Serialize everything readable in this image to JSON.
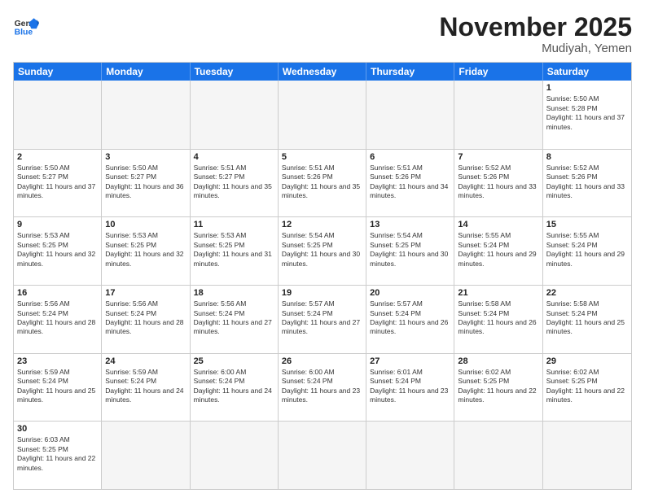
{
  "header": {
    "logo_general": "General",
    "logo_blue": "Blue",
    "month_title": "November 2025",
    "location": "Mudiyah, Yemen"
  },
  "weekdays": [
    "Sunday",
    "Monday",
    "Tuesday",
    "Wednesday",
    "Thursday",
    "Friday",
    "Saturday"
  ],
  "rows": [
    [
      {
        "day": "",
        "text": "",
        "empty": true
      },
      {
        "day": "",
        "text": "",
        "empty": true
      },
      {
        "day": "",
        "text": "",
        "empty": true
      },
      {
        "day": "",
        "text": "",
        "empty": true
      },
      {
        "day": "",
        "text": "",
        "empty": true
      },
      {
        "day": "",
        "text": "",
        "empty": true
      },
      {
        "day": "1",
        "text": "Sunrise: 5:50 AM\nSunset: 5:28 PM\nDaylight: 11 hours and 37 minutes."
      }
    ],
    [
      {
        "day": "2",
        "text": "Sunrise: 5:50 AM\nSunset: 5:27 PM\nDaylight: 11 hours and 37 minutes."
      },
      {
        "day": "3",
        "text": "Sunrise: 5:50 AM\nSunset: 5:27 PM\nDaylight: 11 hours and 36 minutes."
      },
      {
        "day": "4",
        "text": "Sunrise: 5:51 AM\nSunset: 5:27 PM\nDaylight: 11 hours and 35 minutes."
      },
      {
        "day": "5",
        "text": "Sunrise: 5:51 AM\nSunset: 5:26 PM\nDaylight: 11 hours and 35 minutes."
      },
      {
        "day": "6",
        "text": "Sunrise: 5:51 AM\nSunset: 5:26 PM\nDaylight: 11 hours and 34 minutes."
      },
      {
        "day": "7",
        "text": "Sunrise: 5:52 AM\nSunset: 5:26 PM\nDaylight: 11 hours and 33 minutes."
      },
      {
        "day": "8",
        "text": "Sunrise: 5:52 AM\nSunset: 5:26 PM\nDaylight: 11 hours and 33 minutes."
      }
    ],
    [
      {
        "day": "9",
        "text": "Sunrise: 5:53 AM\nSunset: 5:25 PM\nDaylight: 11 hours and 32 minutes."
      },
      {
        "day": "10",
        "text": "Sunrise: 5:53 AM\nSunset: 5:25 PM\nDaylight: 11 hours and 32 minutes."
      },
      {
        "day": "11",
        "text": "Sunrise: 5:53 AM\nSunset: 5:25 PM\nDaylight: 11 hours and 31 minutes."
      },
      {
        "day": "12",
        "text": "Sunrise: 5:54 AM\nSunset: 5:25 PM\nDaylight: 11 hours and 30 minutes."
      },
      {
        "day": "13",
        "text": "Sunrise: 5:54 AM\nSunset: 5:25 PM\nDaylight: 11 hours and 30 minutes."
      },
      {
        "day": "14",
        "text": "Sunrise: 5:55 AM\nSunset: 5:24 PM\nDaylight: 11 hours and 29 minutes."
      },
      {
        "day": "15",
        "text": "Sunrise: 5:55 AM\nSunset: 5:24 PM\nDaylight: 11 hours and 29 minutes."
      }
    ],
    [
      {
        "day": "16",
        "text": "Sunrise: 5:56 AM\nSunset: 5:24 PM\nDaylight: 11 hours and 28 minutes."
      },
      {
        "day": "17",
        "text": "Sunrise: 5:56 AM\nSunset: 5:24 PM\nDaylight: 11 hours and 28 minutes."
      },
      {
        "day": "18",
        "text": "Sunrise: 5:56 AM\nSunset: 5:24 PM\nDaylight: 11 hours and 27 minutes."
      },
      {
        "day": "19",
        "text": "Sunrise: 5:57 AM\nSunset: 5:24 PM\nDaylight: 11 hours and 27 minutes."
      },
      {
        "day": "20",
        "text": "Sunrise: 5:57 AM\nSunset: 5:24 PM\nDaylight: 11 hours and 26 minutes."
      },
      {
        "day": "21",
        "text": "Sunrise: 5:58 AM\nSunset: 5:24 PM\nDaylight: 11 hours and 26 minutes."
      },
      {
        "day": "22",
        "text": "Sunrise: 5:58 AM\nSunset: 5:24 PM\nDaylight: 11 hours and 25 minutes."
      }
    ],
    [
      {
        "day": "23",
        "text": "Sunrise: 5:59 AM\nSunset: 5:24 PM\nDaylight: 11 hours and 25 minutes."
      },
      {
        "day": "24",
        "text": "Sunrise: 5:59 AM\nSunset: 5:24 PM\nDaylight: 11 hours and 24 minutes."
      },
      {
        "day": "25",
        "text": "Sunrise: 6:00 AM\nSunset: 5:24 PM\nDaylight: 11 hours and 24 minutes."
      },
      {
        "day": "26",
        "text": "Sunrise: 6:00 AM\nSunset: 5:24 PM\nDaylight: 11 hours and 23 minutes."
      },
      {
        "day": "27",
        "text": "Sunrise: 6:01 AM\nSunset: 5:24 PM\nDaylight: 11 hours and 23 minutes."
      },
      {
        "day": "28",
        "text": "Sunrise: 6:02 AM\nSunset: 5:25 PM\nDaylight: 11 hours and 22 minutes."
      },
      {
        "day": "29",
        "text": "Sunrise: 6:02 AM\nSunset: 5:25 PM\nDaylight: 11 hours and 22 minutes."
      }
    ],
    [
      {
        "day": "30",
        "text": "Sunrise: 6:03 AM\nSunset: 5:25 PM\nDaylight: 11 hours and 22 minutes."
      },
      {
        "day": "",
        "text": "",
        "empty": true
      },
      {
        "day": "",
        "text": "",
        "empty": true
      },
      {
        "day": "",
        "text": "",
        "empty": true
      },
      {
        "day": "",
        "text": "",
        "empty": true
      },
      {
        "day": "",
        "text": "",
        "empty": true
      },
      {
        "day": "",
        "text": "",
        "empty": true
      }
    ]
  ]
}
